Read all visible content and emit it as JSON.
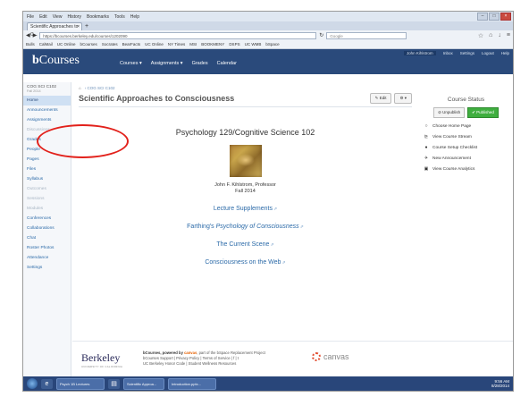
{
  "browser": {
    "menu": [
      "File",
      "Edit",
      "View",
      "History",
      "Bookmarks",
      "Tools",
      "Help"
    ],
    "tab_label": "Scientific Approaches to C...",
    "tab_close": "×",
    "new_tab": "+",
    "url": "https://bcourses.berkeley.edu/courses/1202090",
    "search_placeholder": "Google",
    "bookmarks": [
      "Bulls",
      "CalMail",
      "UC Online",
      "bCourses",
      "Socrates",
      "BearFacts",
      "UC Online",
      "NY Times",
      "MSI",
      "BOOKMENY",
      "DSPS",
      "UC WMB",
      "bSpace"
    ]
  },
  "header": {
    "logo_b": "b",
    "logo_text": "Courses",
    "top_links": [
      "John Kihlstrom",
      "Inbox",
      "Settings",
      "Logout",
      "Help"
    ],
    "nav": [
      "Courses ▾",
      "Assignments ▾",
      "Grades",
      "Calendar"
    ]
  },
  "leftnav": {
    "course_id": "COG SCI C102",
    "term": "Fall 2014",
    "items": [
      {
        "label": "Home",
        "state": "active"
      },
      {
        "label": "Announcements",
        "state": "normal"
      },
      {
        "label": "Assignments",
        "state": "normal"
      },
      {
        "label": "Discussions",
        "state": "disabled"
      },
      {
        "label": "Grades",
        "state": "normal"
      },
      {
        "label": "People",
        "state": "normal"
      },
      {
        "label": "Pages",
        "state": "normal"
      },
      {
        "label": "Files",
        "state": "normal"
      },
      {
        "label": "Syllabus",
        "state": "normal"
      },
      {
        "label": "Outcomes",
        "state": "disabled"
      },
      {
        "label": "Sessions",
        "state": "disabled"
      },
      {
        "label": "Modules",
        "state": "disabled"
      },
      {
        "label": "Conferences",
        "state": "normal"
      },
      {
        "label": "Collaborations",
        "state": "normal"
      },
      {
        "label": "Chat",
        "state": "normal"
      },
      {
        "label": "Roster Photos",
        "state": "normal"
      },
      {
        "label": "Attendance",
        "state": "normal"
      },
      {
        "label": "Settings",
        "state": "normal"
      }
    ]
  },
  "main": {
    "breadcrumb": "COG SCI C102",
    "page_title": "Scientific Approaches to Consciousness",
    "edit_label": "✎ Edit",
    "gear_label": "⚙ ▾",
    "course_title": "Psychology 129/Cognitive Science 102",
    "professor": "John F. Kihlstrom, Professor",
    "term": "Fall 2014",
    "links": [
      {
        "pre": "Lecture Supplements",
        "em": "",
        "post": ""
      },
      {
        "pre": "Farthing's ",
        "em": "Psychology of Consciousness",
        "post": ""
      },
      {
        "pre": "The Current Scene",
        "em": "",
        "post": ""
      },
      {
        "pre": "Consciousness on the Web",
        "em": "",
        "post": ""
      }
    ]
  },
  "status": {
    "title": "Course Status",
    "unpublish": "⊘ Unpublish",
    "published": "✔ Published",
    "items": [
      {
        "icon": "○",
        "label": "Choose Home Page"
      },
      {
        "icon": "⊵",
        "label": "View Course Stream"
      },
      {
        "icon": "●",
        "label": "Course Setup Checklist"
      },
      {
        "icon": "✈",
        "label": "New Announcement"
      },
      {
        "icon": "▣",
        "label": "View Course Analytics"
      }
    ]
  },
  "footer": {
    "berkeley": "Berkeley",
    "berkeley_sub": "UNIVERSITY OF CALIFORNIA",
    "powered_pre": "bCourses, powered by ",
    "powered_canvas": "canvas",
    "powered_post": ", part of the bSpace Replacement Project",
    "line2": "bCourses Support | Privacy Policy | Terms of Service | f | t",
    "line3": "UC Berkeley Honor Code | Student Wellness Resources",
    "canvas_logo": "canvas"
  },
  "taskbar": {
    "apps": [
      "Psych 1B Lectures",
      "Scientific Approa...",
      "Introduction.pptx..."
    ],
    "time": "9:56 AM",
    "date": "8/28/2014"
  }
}
